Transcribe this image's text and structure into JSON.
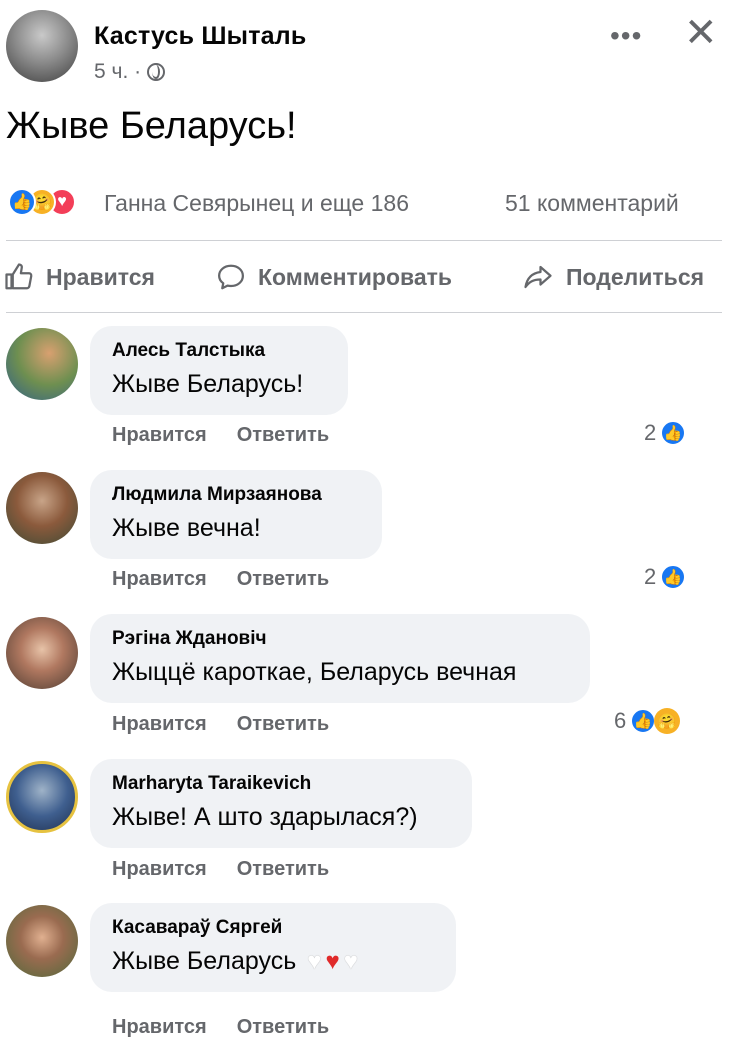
{
  "post": {
    "author": "Кастусь Шыталь",
    "time": "5 ч. ·",
    "text": "Жыве Беларусь!",
    "menu_icon": "more-icon",
    "close_icon": "close-icon"
  },
  "reactions": {
    "names": "Ганна Севярынец и еще 186",
    "comments": "51 комментарий",
    "colors": {
      "like": "#1877f2",
      "care": "#f7b125",
      "love": "#f33e58"
    }
  },
  "actions": {
    "like": "Нравится",
    "comment": "Комментировать",
    "share": "Поделиться"
  },
  "comments": [
    {
      "name": "Алесь Талстыка",
      "text": "Жыве Беларусь!",
      "like": "Нравится",
      "reply": "Ответить",
      "count": "2"
    },
    {
      "name": "Людмила Мирзаянова",
      "text": "Жыве вечна!",
      "like": "Нравится",
      "reply": "Ответить",
      "count": "2"
    },
    {
      "name": "Рэгiна Ждановiч",
      "text": "Жыццё кароткае, Беларусь вечная",
      "like": "Нравится",
      "reply": "Ответить",
      "count": "6"
    },
    {
      "name": "Marharyta Taraikevich",
      "text": "Жыве! А што здарылася?)",
      "like": "Нравится",
      "reply": "Ответить",
      "count": ""
    },
    {
      "name": "Касавараў Сяргей",
      "text": "Жыве Беларусь",
      "like": "Нравится",
      "reply": "Ответить",
      "count": ""
    }
  ]
}
